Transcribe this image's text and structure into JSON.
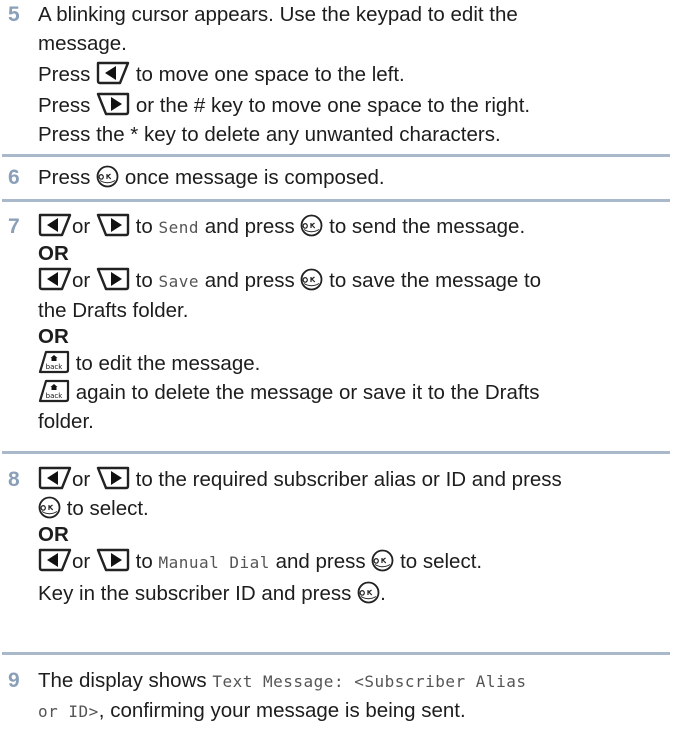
{
  "steps": [
    {
      "number": "5",
      "line1": "A blinking cursor appears. Use the keypad to edit the",
      "line2": "message.",
      "left_pre": "Press",
      "left_post": "to move one space to the left.",
      "right_pre": "Press",
      "right_post": "or the # key to move one space to the right.",
      "delete": "Press the * key to delete any unwanted characters."
    },
    {
      "number": "6",
      "pre": "Press",
      "post": "once message is composed."
    },
    {
      "number": "7",
      "or_text": "or",
      "send_to": "to",
      "send_lcd": "Send",
      "send_and": "and press",
      "send_post": "to send the message.",
      "or_label": "OR",
      "save_to": "to",
      "save_lcd": "Save",
      "save_and": "and press",
      "save_post": "to save the message to",
      "save_cont": "the Drafts folder.",
      "or_label_2": "OR",
      "back_post": "to edit the message.",
      "back_again_post": "again to delete the message or save it to the Drafts",
      "back_again_cont": "folder."
    },
    {
      "number": "8",
      "or_text": "or",
      "alias_post": "to the required subscriber alias or ID and press",
      "select_post": "to select.",
      "or_label": "OR",
      "manual_to": "to",
      "manual_lcd": "Manual Dial",
      "manual_and": "and press",
      "manual_post": "to select.",
      "keyin_pre": "Key in the subscriber ID and press",
      "keyin_post": "."
    },
    {
      "number": "9",
      "pre": "The display shows",
      "lcd1": "Text Message: <Subscriber Alias",
      "lcd2": "or ID>",
      "post": ", confirming your message is being sent."
    }
  ],
  "icons": {
    "left": "left-arrow-key-icon",
    "right": "right-arrow-key-icon",
    "ok": "ok-key-icon",
    "back": "back-key-icon"
  },
  "colors": {
    "step_number": "#8a9fb8",
    "rule": "#a9b8cb",
    "text": "#1d1d1d"
  }
}
